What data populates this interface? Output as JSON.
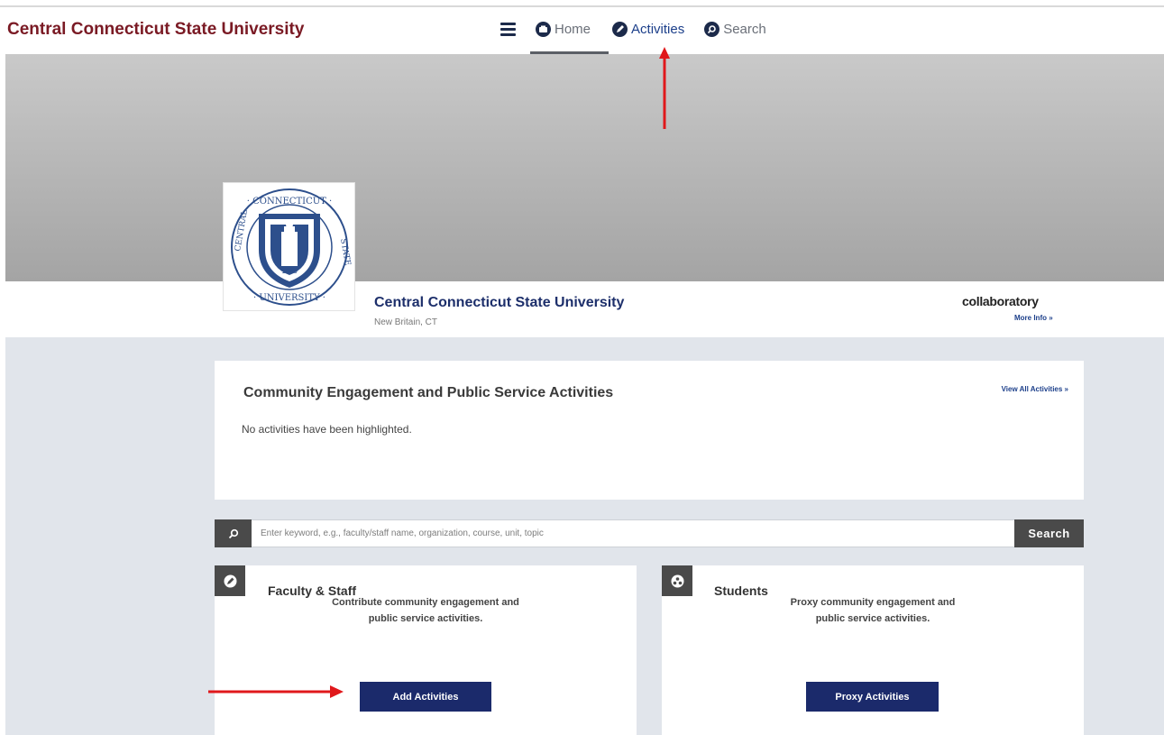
{
  "header": {
    "brand": "Central Connecticut State University",
    "nav": [
      {
        "label": "Home",
        "icon": "home-icon"
      },
      {
        "label": "Activities",
        "icon": "activities-icon"
      },
      {
        "label": "Search",
        "icon": "search-icon"
      }
    ]
  },
  "profile": {
    "name": "Central Connecticut State University",
    "location": "New Britain, CT",
    "partner_logo": "collaboratory",
    "more_info": "More Info »"
  },
  "highlights": {
    "title": "Community Engagement and Public Service Activities",
    "view_all": "View All Activities »",
    "empty_message": "No activities have been highlighted."
  },
  "search": {
    "placeholder": "Enter keyword, e.g., faculty/staff name, organization, course, unit, topic",
    "button": "Search"
  },
  "cards": {
    "faculty": {
      "title": "Faculty & Staff",
      "desc_line1": "Contribute community engagement and",
      "desc_line2": "public service activities.",
      "button": "Add Activities",
      "icon": "pencil-icon"
    },
    "students": {
      "title": "Students",
      "desc_line1": "Proxy community engagement and",
      "desc_line2": "public service activities.",
      "button": "Proxy Activities",
      "icon": "people-icon"
    }
  },
  "colors": {
    "brand": "#7a1a24",
    "navy": "#1b2a6b",
    "annotation": "#e0181b",
    "content_bg": "#e1e5eb"
  }
}
